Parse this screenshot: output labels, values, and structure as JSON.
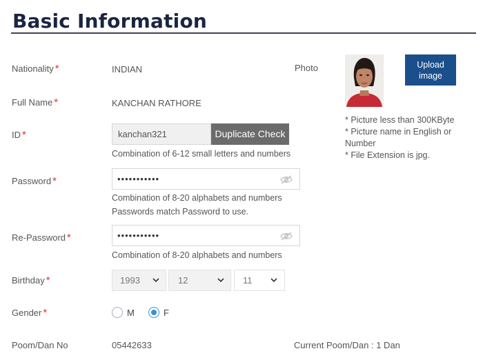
{
  "section": {
    "title": "Basic Information"
  },
  "required_mark": "*",
  "nationality": {
    "label": "Nationality",
    "value": "INDIAN"
  },
  "full_name": {
    "label": "Full Name",
    "value": "KANCHAN RATHORE"
  },
  "id": {
    "label": "ID",
    "value": "kanchan321",
    "duplicate_button": "Duplicate Check",
    "hint": "Combination of 6-12 small letters and numbers"
  },
  "password": {
    "label": "Password",
    "masked": "•••••••••••",
    "hint1": "Combination of 8-20 alphabets and numbers",
    "hint2": "Passwords match Password to use."
  },
  "repassword": {
    "label": "Re-Password",
    "masked": "•••••••••••",
    "hint": "Combination of 8-20 alphabets and numbers"
  },
  "birthday": {
    "label": "Birthday",
    "year": "1993",
    "month": "12",
    "day": "11"
  },
  "gender": {
    "label": "Gender",
    "options": [
      "M",
      "F"
    ],
    "selected": "F"
  },
  "poom": {
    "label": "Poom/Dan No",
    "value": "05442633",
    "current": "Current Poom/Dan : 1 Dan"
  },
  "photo": {
    "label": "Photo",
    "upload_line1": "Upload",
    "upload_line2": "image",
    "note1": "* Picture less than 300KByte",
    "note2": "* Picture name in English or Number",
    "note3": "* File Extension is jpg."
  },
  "colors": {
    "accent": "#1b4f8c",
    "required": "#e0323a",
    "radio": "#3b8fd6",
    "dup_button": "#6b6b6b"
  },
  "icons": [
    "eye-off-icon",
    "chevron-down-icon"
  ]
}
